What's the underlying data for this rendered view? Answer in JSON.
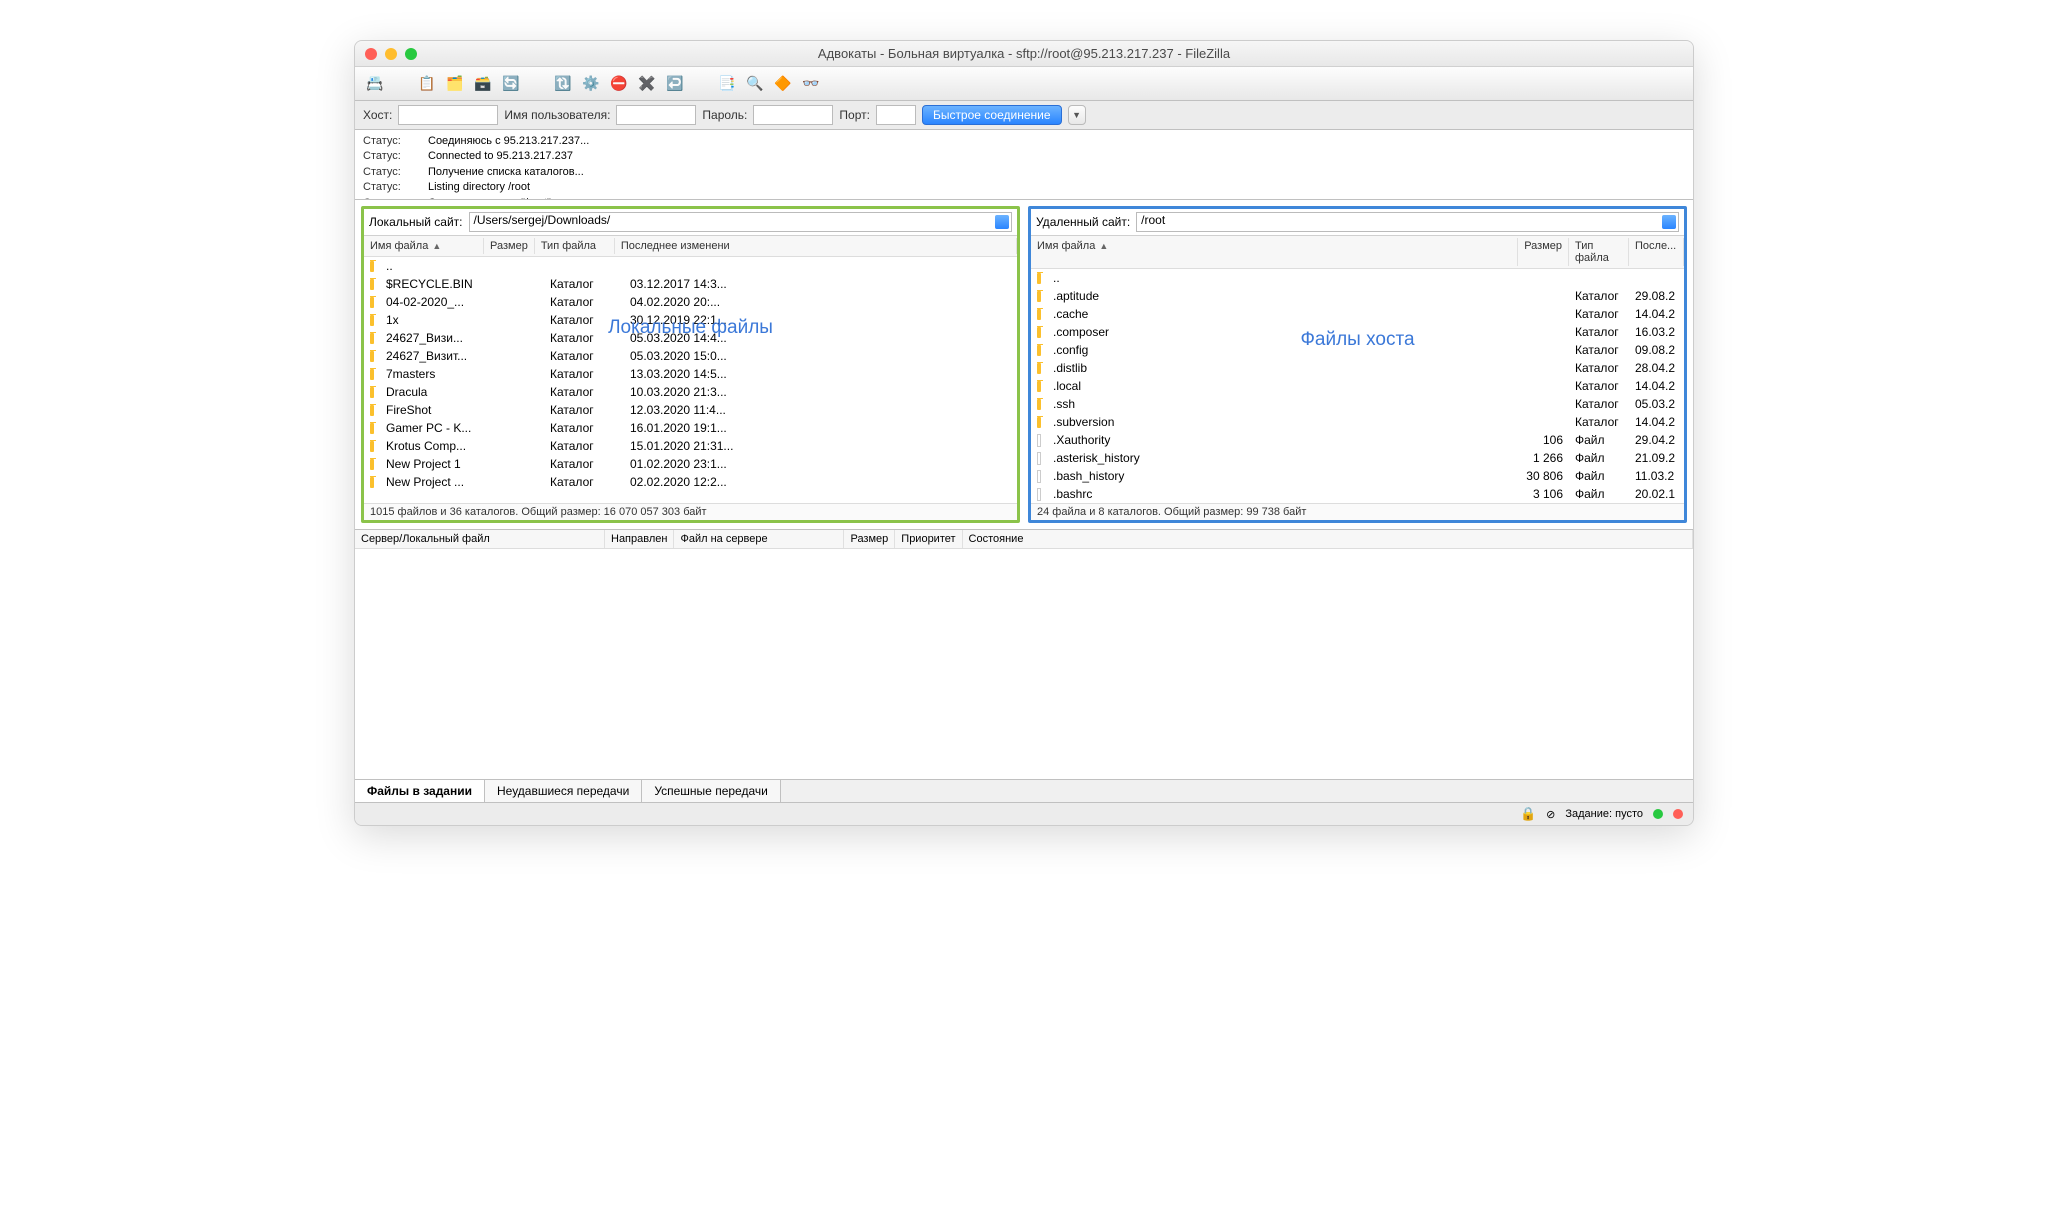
{
  "window": {
    "title": "Адвокаты - Больная виртуалка - sftp://root@95.213.217.237 - FileZilla"
  },
  "quickconnect": {
    "host_label": "Хост:",
    "user_label": "Имя пользователя:",
    "pass_label": "Пароль:",
    "port_label": "Порт:",
    "button": "Быстрое соединение"
  },
  "log": [
    {
      "label": "Статус:",
      "msg": "Соединяюсь с 95.213.217.237..."
    },
    {
      "label": "Статус:",
      "msg": "Connected to 95.213.217.237"
    },
    {
      "label": "Статус:",
      "msg": "Получение списка каталогов..."
    },
    {
      "label": "Статус:",
      "msg": "Listing directory /root"
    },
    {
      "label": "Статус:",
      "msg": "Список каталогов \"/root\" извлечен"
    }
  ],
  "local": {
    "label": "Локальный сайт:",
    "path": "/Users/sergej/Downloads/",
    "overlay": "Локальные файлы",
    "columns": {
      "name": "Имя файла",
      "size": "Размер",
      "type": "Тип файла",
      "date": "Последнее изменени"
    },
    "files": [
      {
        "name": "..",
        "type": "",
        "date": "",
        "icon": "folder"
      },
      {
        "name": "$RECYCLE.BIN",
        "type": "Каталог",
        "date": "03.12.2017 14:3...",
        "icon": "folder"
      },
      {
        "name": "04-02-2020_...",
        "type": "Каталог",
        "date": "04.02.2020 20:...",
        "icon": "folder"
      },
      {
        "name": "1x",
        "type": "Каталог",
        "date": "30.12.2019 22:1...",
        "icon": "folder"
      },
      {
        "name": "24627_Визи...",
        "type": "Каталог",
        "date": "05.03.2020 14:4...",
        "icon": "folder"
      },
      {
        "name": "24627_Визит...",
        "type": "Каталог",
        "date": "05.03.2020 15:0...",
        "icon": "folder"
      },
      {
        "name": "7masters",
        "type": "Каталог",
        "date": "13.03.2020 14:5...",
        "icon": "folder"
      },
      {
        "name": "Dracula",
        "type": "Каталог",
        "date": "10.03.2020 21:3...",
        "icon": "folder"
      },
      {
        "name": "FireShot",
        "type": "Каталог",
        "date": "12.03.2020 11:4...",
        "icon": "folder"
      },
      {
        "name": "Gamer PC - K...",
        "type": "Каталог",
        "date": "16.01.2020 19:1...",
        "icon": "folder"
      },
      {
        "name": "Krotus Comp...",
        "type": "Каталог",
        "date": "15.01.2020 21:31...",
        "icon": "folder"
      },
      {
        "name": "New Project 1",
        "type": "Каталог",
        "date": "01.02.2020 23:1...",
        "icon": "folder"
      },
      {
        "name": "New Project ...",
        "type": "Каталог",
        "date": "02.02.2020 12:2...",
        "icon": "folder"
      }
    ],
    "status": "1015 файлов и 36 каталогов. Общий размер: 16 070 057 303 байт"
  },
  "remote": {
    "label": "Удаленный сайт:",
    "path": "/root",
    "overlay": "Файлы хоста",
    "columns": {
      "name": "Имя файла",
      "size": "Размер",
      "type": "Тип файла",
      "date": "После..."
    },
    "files": [
      {
        "name": "..",
        "size": "",
        "type": "",
        "date": "",
        "icon": "folder"
      },
      {
        "name": ".aptitude",
        "size": "",
        "type": "Каталог",
        "date": "29.08.2",
        "icon": "folder"
      },
      {
        "name": ".cache",
        "size": "",
        "type": "Каталог",
        "date": "14.04.2",
        "icon": "folder"
      },
      {
        "name": ".composer",
        "size": "",
        "type": "Каталог",
        "date": "16.03.2",
        "icon": "folder"
      },
      {
        "name": ".config",
        "size": "",
        "type": "Каталог",
        "date": "09.08.2",
        "icon": "folder"
      },
      {
        "name": ".distlib",
        "size": "",
        "type": "Каталог",
        "date": "28.04.2",
        "icon": "folder"
      },
      {
        "name": ".local",
        "size": "",
        "type": "Каталог",
        "date": "14.04.2",
        "icon": "folder"
      },
      {
        "name": ".ssh",
        "size": "",
        "type": "Каталог",
        "date": "05.03.2",
        "icon": "folder"
      },
      {
        "name": ".subversion",
        "size": "",
        "type": "Каталог",
        "date": "14.04.2",
        "icon": "folder"
      },
      {
        "name": ".Xauthority",
        "size": "106",
        "type": "Файл",
        "date": "29.04.2",
        "icon": "file"
      },
      {
        "name": ".asterisk_history",
        "size": "1 266",
        "type": "Файл",
        "date": "21.09.2",
        "icon": "file"
      },
      {
        "name": ".bash_history",
        "size": "30 806",
        "type": "Файл",
        "date": "11.03.2",
        "icon": "file"
      },
      {
        "name": ".bashrc",
        "size": "3 106",
        "type": "Файл",
        "date": "20.02.1",
        "icon": "file"
      }
    ],
    "status": "24 файла и 8 каталогов. Общий размер: 99 738 байт"
  },
  "queue": {
    "columns": {
      "server": "Сервер/Локальный файл",
      "dir": "Направлен",
      "remote": "Файл на сервере",
      "size": "Размер",
      "prio": "Приоритет",
      "state": "Состояние"
    }
  },
  "tabs": {
    "queued": "Файлы в задании",
    "failed": "Неудавшиеся передачи",
    "success": "Успешные передачи"
  },
  "statusbar": {
    "queue": "Задание: пусто"
  }
}
